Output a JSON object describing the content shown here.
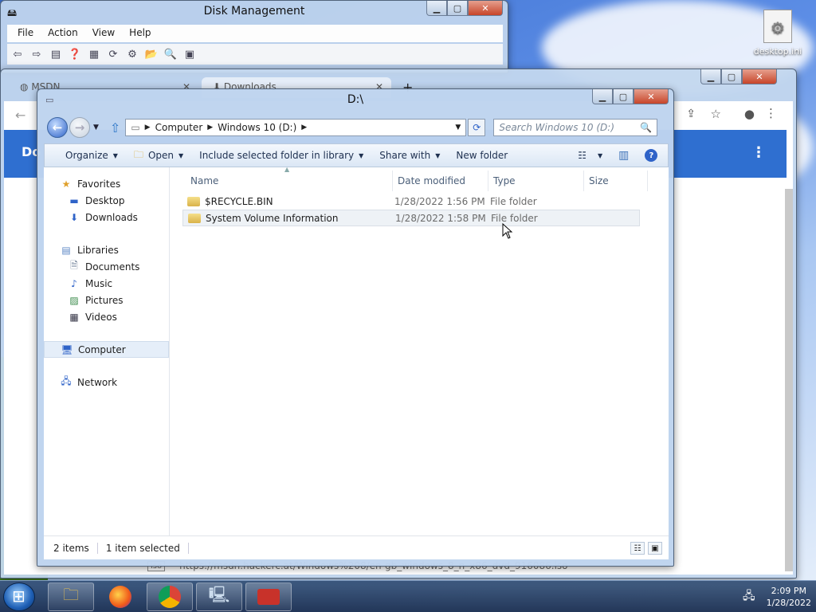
{
  "colors": {
    "accent": "#2f6fd0",
    "selection": "#e5eef9"
  },
  "desktop": {
    "icon_label": "desktop.ini"
  },
  "disk_management": {
    "title": "Disk Management",
    "menu": [
      "File",
      "Action",
      "View",
      "Help"
    ]
  },
  "chrome": {
    "tabs": [
      {
        "label": "MSDN",
        "icon": "globe-icon"
      },
      {
        "label": "Downloads",
        "icon": "download-icon"
      }
    ],
    "new_tab_label": "+",
    "page_heading": "Do",
    "download_bar": {
      "icon_text": "iso",
      "url": "https://msdn.hackerc.at/Windows%208/en-gb_windows_8_n_x86_dvd_916086.iso"
    }
  },
  "explorer": {
    "title": "D:\\",
    "breadcrumb": [
      "Computer",
      "Windows 10 (D:)"
    ],
    "search_placeholder": "Search Windows 10 (D:)",
    "commands": {
      "organize": "Organize",
      "open": "Open",
      "include": "Include selected folder in library",
      "share": "Share with",
      "new_folder": "New folder"
    },
    "nav": {
      "favorites": {
        "label": "Favorites",
        "items": [
          "Desktop",
          "Downloads"
        ]
      },
      "libraries": {
        "label": "Libraries",
        "items": [
          "Documents",
          "Music",
          "Pictures",
          "Videos"
        ]
      },
      "computer": "Computer",
      "network": "Network"
    },
    "columns": [
      "Name",
      "Date modified",
      "Type",
      "Size"
    ],
    "files": [
      {
        "name": "$RECYCLE.BIN",
        "date": "1/28/2022 1:56 PM",
        "type": "File folder",
        "size": ""
      },
      {
        "name": "System Volume Information",
        "date": "1/28/2022 1:58 PM",
        "type": "File folder",
        "size": ""
      }
    ],
    "status": {
      "count": "2 items",
      "selected": "1 item selected"
    }
  },
  "taskbar": {
    "time": "2:09 PM",
    "date": "1/28/2022",
    "items": [
      "explorer-icon",
      "firefox-icon",
      "chrome-icon",
      "network-computer-icon",
      "toolbox-icon"
    ]
  }
}
